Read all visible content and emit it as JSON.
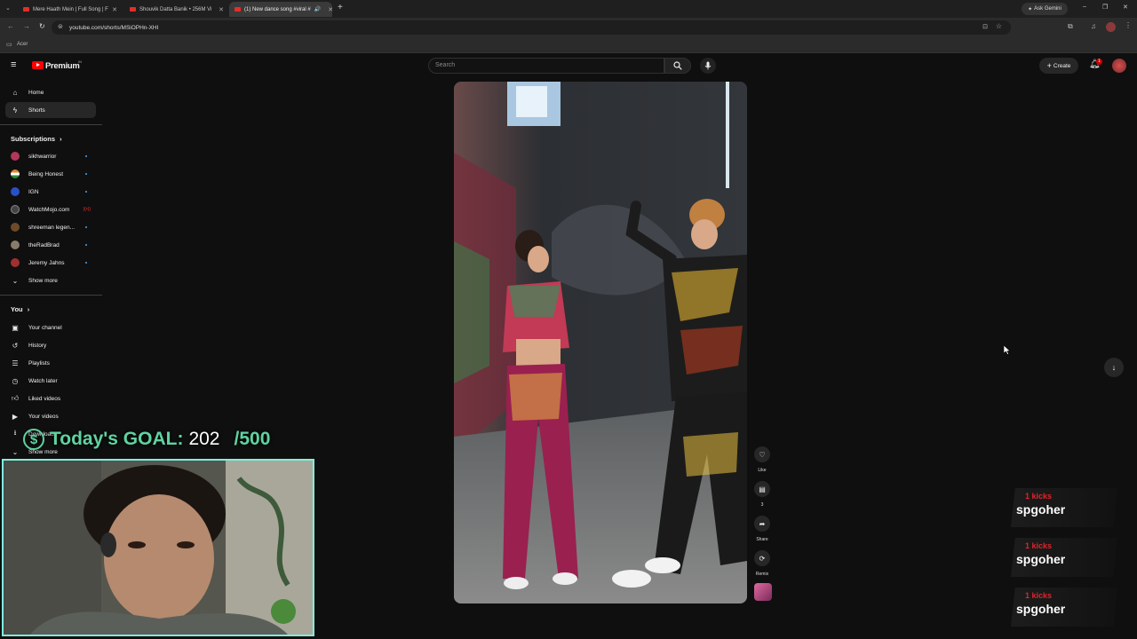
{
  "browser": {
    "tabs": [
      {
        "label": "Mere Haath Mein | Full Song | F"
      },
      {
        "label": "Shouvik Datta Banik • 256M Vi"
      },
      {
        "label": "(1) New dance song #viral #"
      }
    ],
    "new_tab": "+",
    "gemini": "Ask Gemini",
    "url": "youtube.com/shorts/MSiOPHn-XHI",
    "bookmark": "Acer"
  },
  "youtube": {
    "logo_text": "Premium",
    "logo_sup": "IN",
    "search_placeholder": "Search",
    "create_label": "Create",
    "notif_count": "1"
  },
  "sidebar": {
    "main": [
      {
        "label": "Home",
        "icon": "home-icon"
      },
      {
        "label": "Shorts",
        "icon": "shorts-icon"
      }
    ],
    "subscriptions_title": "Subscriptions",
    "subscriptions": [
      {
        "label": "sikhwarrior",
        "color": "#b0385a"
      },
      {
        "label": "Being Honest",
        "color": "#e08a2e"
      },
      {
        "label": "IGN",
        "color": "#2850c8"
      },
      {
        "label": "WatchMojo.com",
        "color": "#444444"
      },
      {
        "label": "shreeman legen...",
        "color": "#6d4a2a"
      },
      {
        "label": "theRadBrad",
        "color": "#8a7a6a"
      },
      {
        "label": "Jeremy Jahns",
        "color": "#a03030"
      }
    ],
    "show_more": "Show more",
    "you_title": "You",
    "you": [
      {
        "label": "Your channel",
        "icon": "channel-icon"
      },
      {
        "label": "History",
        "icon": "history-icon"
      },
      {
        "label": "Playlists",
        "icon": "playlists-icon"
      },
      {
        "label": "Watch later",
        "icon": "clock-icon"
      },
      {
        "label": "Liked videos",
        "icon": "like-icon"
      },
      {
        "label": "Your videos",
        "icon": "video-icon"
      },
      {
        "label": "Downloads",
        "icon": "download-icon"
      }
    ],
    "show_more_2": "Show more"
  },
  "shorts_actions": {
    "like": "Like",
    "comments": "3",
    "share": "Share",
    "remix": "Remix"
  },
  "overlay": {
    "goal_label": "Today's GOAL:",
    "goal_current": "202",
    "goal_target": "/500",
    "coin": "$",
    "kicks": [
      {
        "amount": "1 kicks",
        "user": "spgoher"
      },
      {
        "amount": "1 kicks",
        "user": "spgoher"
      },
      {
        "amount": "1 kicks",
        "user": "spgoher"
      }
    ]
  }
}
